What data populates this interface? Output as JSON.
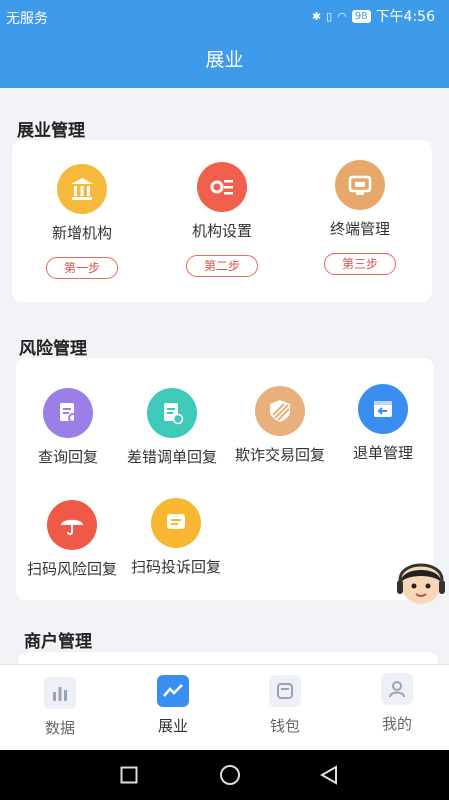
{
  "status_bar": {
    "carrier": "无服务",
    "battery": "98",
    "time": "下午4:56"
  },
  "nav": {
    "title": "展业"
  },
  "sections": {
    "zhanye": {
      "title": "展业管理",
      "items": [
        {
          "label": "新增机构",
          "step": "第一步",
          "icon": "bank-icon",
          "color": "#f6b93b"
        },
        {
          "label": "机构设置",
          "step": "第二步",
          "icon": "settings-list-icon",
          "color": "#f0604d"
        },
        {
          "label": "终端管理",
          "step": "第三步",
          "icon": "terminal-icon",
          "color": "#e8a86b"
        }
      ]
    },
    "risk": {
      "title": "风险管理",
      "items": [
        {
          "label": "查询回复",
          "icon": "document-search-icon",
          "color": "#9b7ee6"
        },
        {
          "label": "差错调单回复",
          "icon": "document-error-icon",
          "color": "#3ec9b8"
        },
        {
          "label": "欺诈交易回复",
          "icon": "shield-stripes-icon",
          "color": "#e8b07a"
        },
        {
          "label": "退单管理",
          "icon": "return-box-icon",
          "color": "#3a8ef0"
        },
        {
          "label": "扫码风险回复",
          "icon": "umbrella-icon",
          "color": "#ee5a47"
        },
        {
          "label": "扫码投诉回复",
          "icon": "message-icon",
          "color": "#f7b731"
        }
      ]
    },
    "merchant": {
      "title": "商户管理"
    }
  },
  "tabs": [
    {
      "label": "数据",
      "icon": "bar-chart-icon",
      "active": false
    },
    {
      "label": "展业",
      "icon": "trend-line-icon",
      "active": true
    },
    {
      "label": "钱包",
      "icon": "wallet-icon",
      "active": false
    },
    {
      "label": "我的",
      "icon": "person-icon",
      "active": false
    }
  ],
  "colors": {
    "primary": "#3d9be9",
    "step_border": "#e06b5f"
  }
}
